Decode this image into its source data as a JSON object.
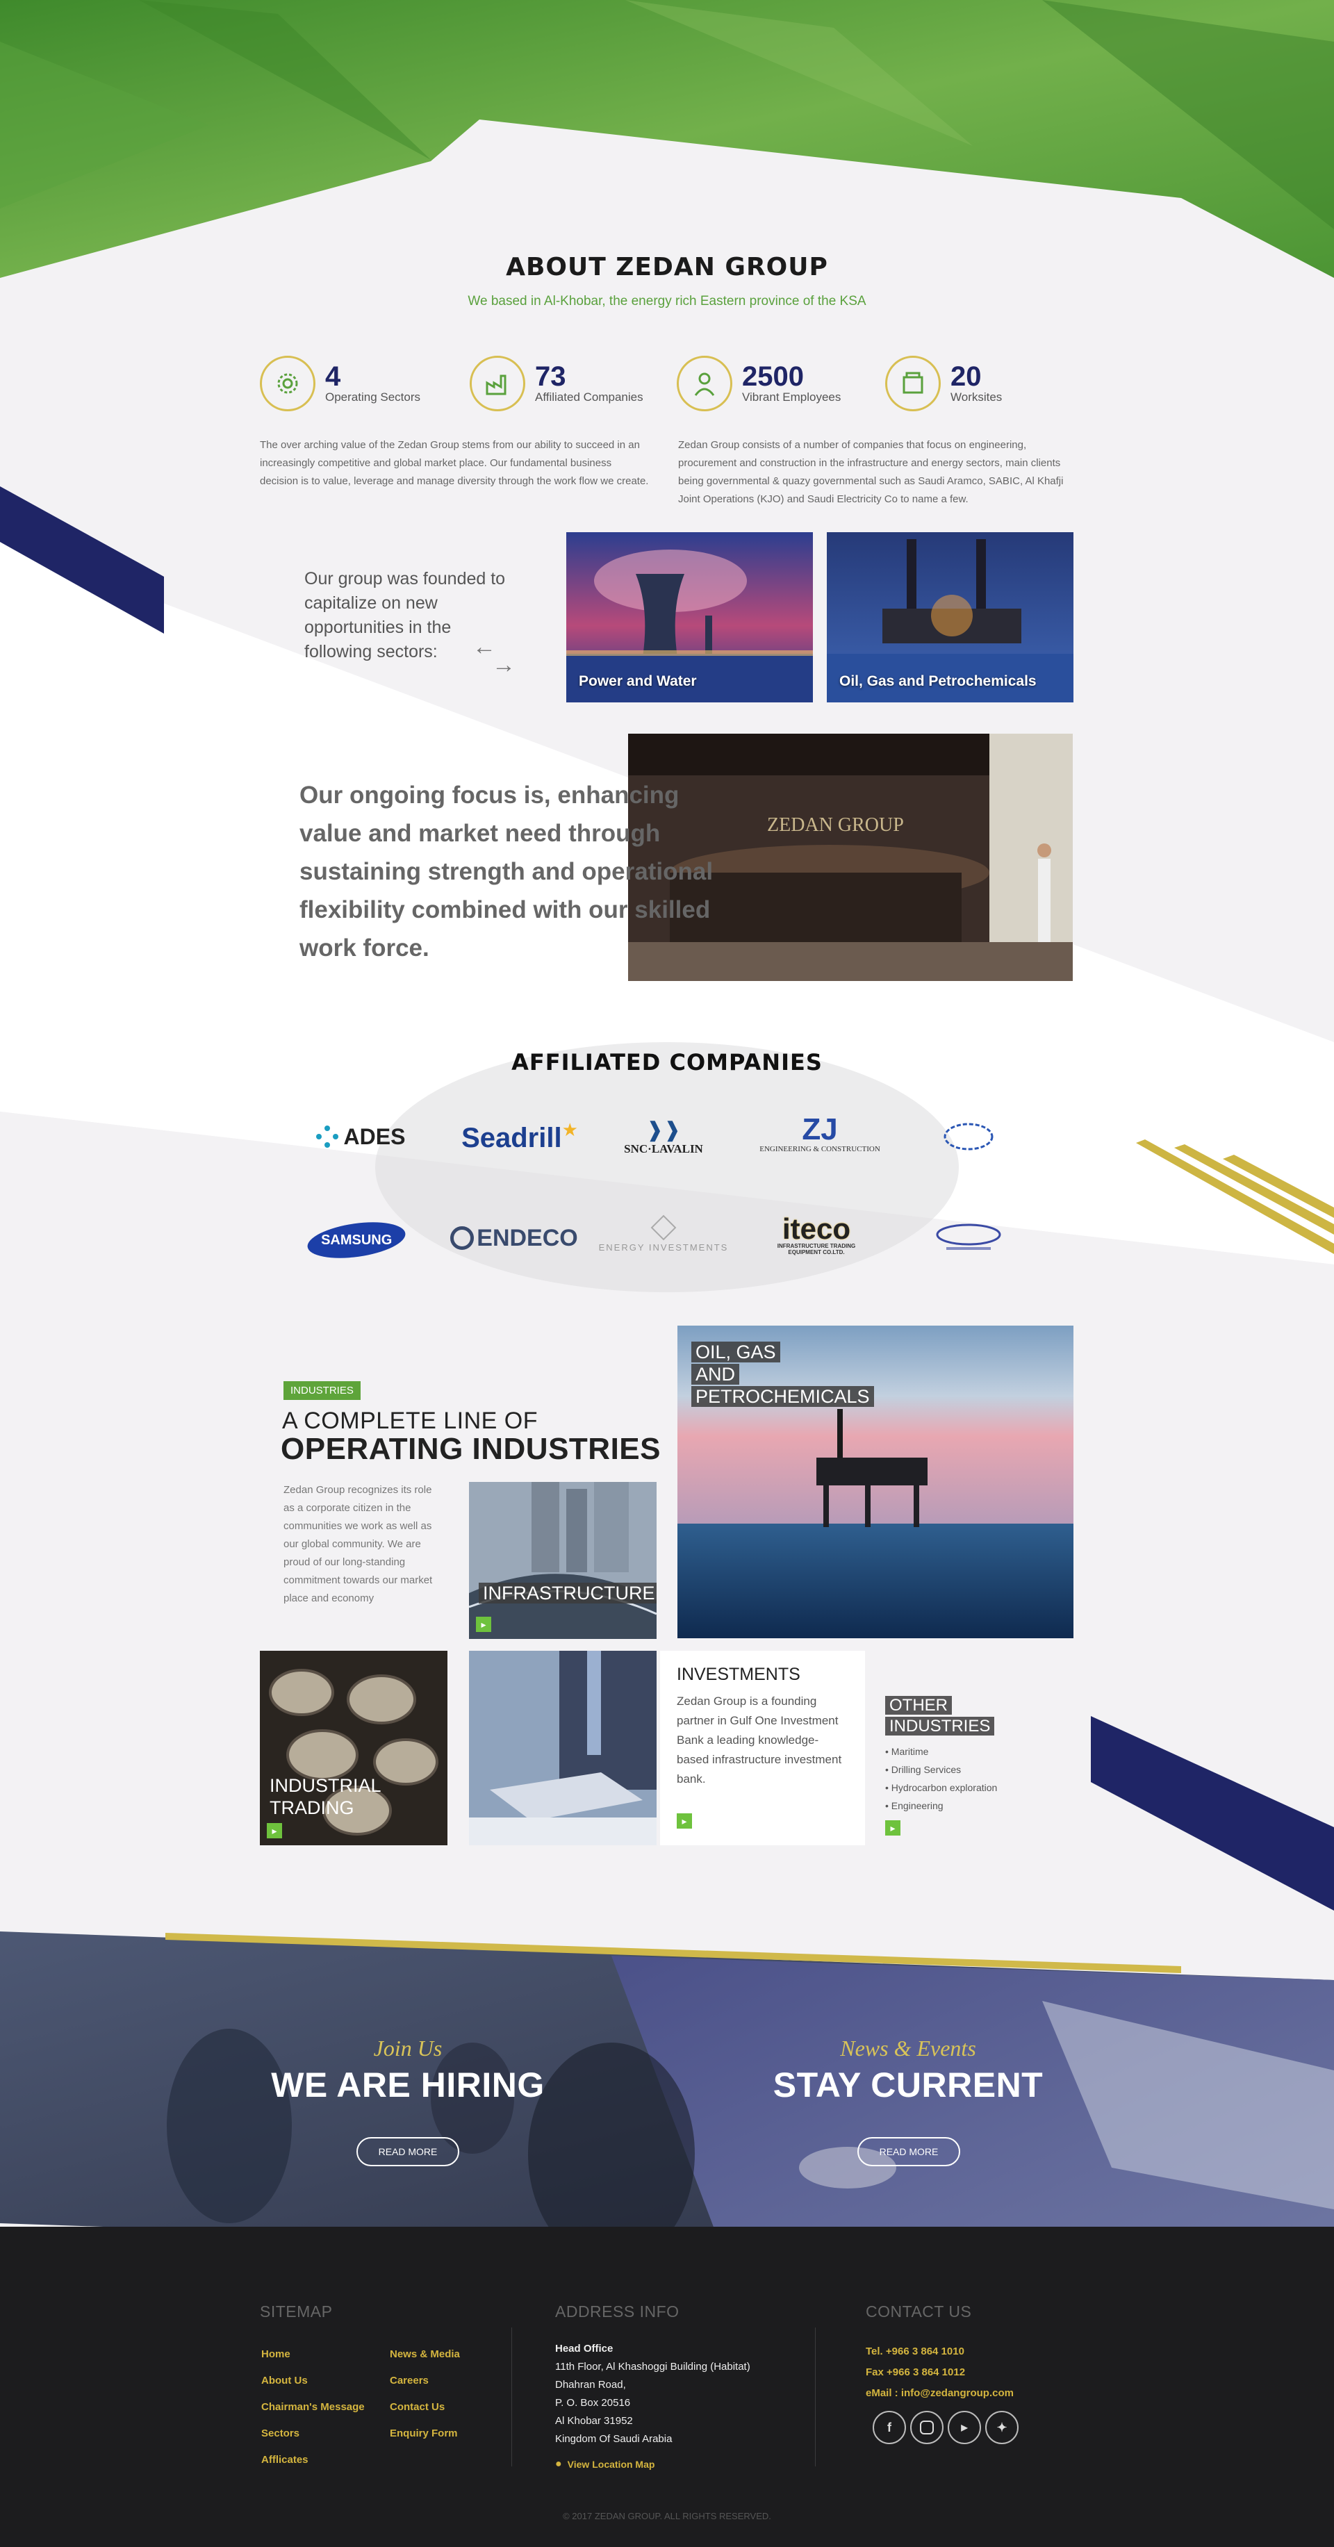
{
  "colors": {
    "green": "#5aa13d",
    "navy": "#1f2566",
    "gold": "#d8bf52",
    "footer_bg": "#1c1c1e"
  },
  "about": {
    "title": "ABOUT ZEDAN GROUP",
    "subtitle": "We based in Al-Khobar, the energy rich Eastern province of the KSA",
    "stats": [
      {
        "icon": "gears-icon",
        "number": "4",
        "label": "Operating Sectors"
      },
      {
        "icon": "factory-icon",
        "number": "73",
        "label": "Affiliated Companies"
      },
      {
        "icon": "worker-icon",
        "number": "2500",
        "label": "Vibrant Employees"
      },
      {
        "icon": "site-icon",
        "number": "20",
        "label": "Worksites"
      }
    ],
    "para_left": "The over arching value of the Zedan Group stems from our ability to succeed in an increasingly competitive and global market place. Our fundamental business decision is to value, leverage and manage diversity through the work flow we create.",
    "para_right": "Zedan Group consists of a number of companies that focus on engineering, procurement and construction in the infrastructure and energy sectors, main clients being governmental & quazy governmental such as Saudi Aramco, SABIC, Al Khafji Joint Operations (KJO) and Saudi Electricity Co to name a few."
  },
  "sectors": {
    "intro": "Our group was founded to capitalize on new opportunities in the following sectors:",
    "cards": [
      "Power and Water",
      "Oil, Gas and Petrochemicals"
    ]
  },
  "focus": {
    "text": "Our ongoing focus is, enhancing value and market need through sustaining strength and operational flexibility combined with our skilled work force.",
    "sign": "ZEDAN GROUP"
  },
  "affiliated": {
    "title": "AFFILIATED COMPANIES",
    "logos_row1": [
      "ADES",
      "Seadrill",
      "SNC·LAVALIN",
      "ZJ",
      "ENGINEERING & CONSTRUCTION"
    ],
    "logos_row2": [
      "SAMSUNG",
      "ENDECO",
      "ENERGY INVESTMENTS",
      "iteco",
      "INFRASTRUCTURE TRADING EQUIPMENT CO.LTD."
    ]
  },
  "industries": {
    "tag": "INDUSTRIES",
    "heading_1": "A COMPLETE LINE OF",
    "heading_2": "OPERATING INDUSTRIES",
    "text": "Zedan Group recognizes its role as a corporate citizen in the communities we work as well as our global community. We are proud of our long-standing commitment towards our market place and economy",
    "oil_gas": [
      "OIL, GAS",
      "AND",
      "PETROCHEMICALS"
    ],
    "infrastructure": "INFRASTRUCTURE",
    "industrial": [
      "INDUSTRIAL",
      "TRADING"
    ],
    "investments_title": "INVESTMENTS",
    "investments_text": "Zedan Group is a founding partner in Gulf One Investment Bank a leading knowledge-based infrastructure investment bank.",
    "other_title": [
      "OTHER",
      "INDUSTRIES"
    ],
    "other_items": [
      "Maritime",
      "Drilling Services",
      "Hydrocarbon exploration",
      "Engineering"
    ]
  },
  "cta": {
    "left_small": "Join Us",
    "left_big": "WE ARE HIRING",
    "right_small": "News & Events",
    "right_big": "STAY CURRENT",
    "button": "READ MORE"
  },
  "footer": {
    "sitemap_title": "SITEMAP",
    "sitemap_col1": [
      "Home",
      "About Us",
      "Chairman's Message",
      "Sectors",
      "Afflicates"
    ],
    "sitemap_col2": [
      "News & Media",
      "Careers",
      "Contact Us",
      "Enquiry Form"
    ],
    "address_title": "ADDRESS INFO",
    "address_head": "Head Office",
    "address_lines": [
      "11th Floor, Al Khashoggi Building (Habitat)",
      "Dhahran Road,",
      "P. O. Box 20516",
      "Al Khobar 31952",
      "Kingdom Of Saudi Arabia"
    ],
    "location_link": "View Location Map",
    "contact_title": "CONTACT US",
    "tel": "Tel. +966 3 864 1010",
    "fax": "Fax +966 3 864 1012",
    "email": "eMail : info@zedangroup.com",
    "social": [
      "facebook-icon",
      "instagram-icon",
      "youtube-icon",
      "twitter-icon"
    ],
    "copyright": "© 2017 ZEDAN GROUP. ALL RIGHTS RESERVED."
  }
}
